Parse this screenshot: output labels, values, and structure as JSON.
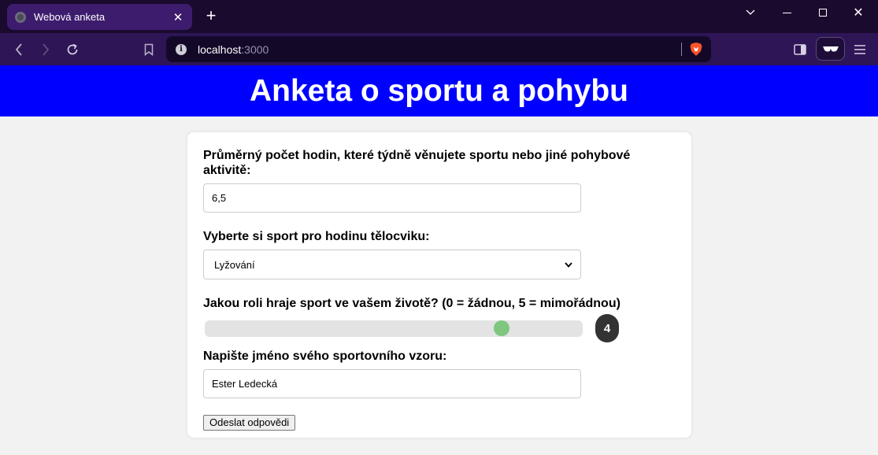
{
  "browser": {
    "tab": {
      "title": "Webová anketa",
      "close_label": "✕"
    },
    "new_tab_label": "+",
    "window_controls": {
      "close_label": "✕",
      "dropdown_label": "⌵"
    },
    "address": {
      "host": "localhost",
      "port": ":3000"
    },
    "colors": {
      "tabbar": "#1a0a2e",
      "active_tab": "#3d1c6e",
      "toolbar": "#2e1555",
      "urlbar": "#130828"
    },
    "icons": [
      "globe-icon",
      "back-icon",
      "forward-icon",
      "reload-icon",
      "bookmark-icon",
      "info-icon",
      "brave-shield-icon",
      "sidebar-icon",
      "reader-mode-icon",
      "menu-icon"
    ]
  },
  "page": {
    "title": "Anketa o sportu a pohybu",
    "header_color": "#0000ff",
    "questions": {
      "hours": {
        "label": "Průměrný počet hodin, které týdně věnujete sportu nebo jiné pohybové aktivitě:",
        "value": "6,5"
      },
      "sport": {
        "label": "Vyberte si sport pro hodinu tělocviku:",
        "selected": "Lyžování"
      },
      "importance": {
        "label": "Jakou roli hraje sport ve vašem životě? (0 = žádnou, 5 = mimořádnou)",
        "value": "4",
        "min": 0,
        "max": 5,
        "thumb_color": "#7fc67f"
      },
      "idol": {
        "label": "Napište jméno svého sportovního vzoru:",
        "value": "Ester Ledecká"
      }
    },
    "submit_label": "Odeslat odpovědi"
  }
}
